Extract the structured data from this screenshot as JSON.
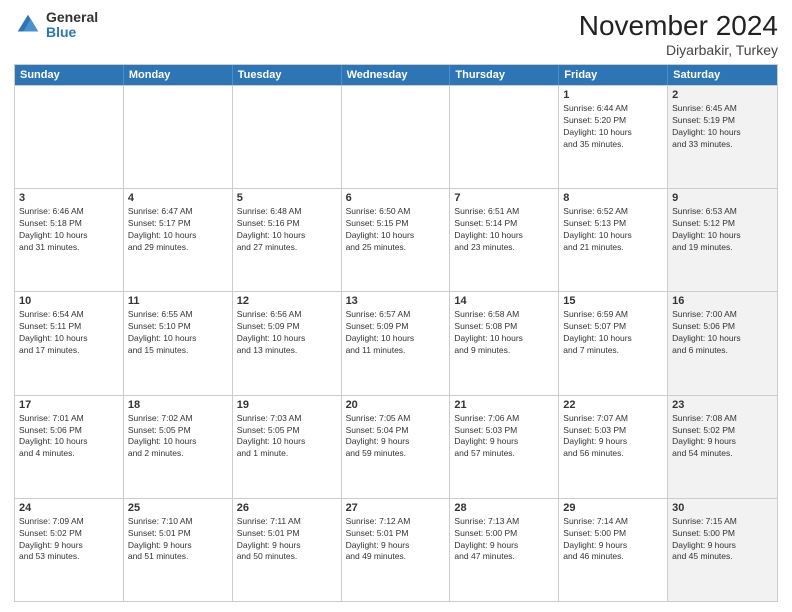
{
  "logo": {
    "general": "General",
    "blue": "Blue"
  },
  "header": {
    "month": "November 2024",
    "location": "Diyarbakir, Turkey"
  },
  "days": [
    "Sunday",
    "Monday",
    "Tuesday",
    "Wednesday",
    "Thursday",
    "Friday",
    "Saturday"
  ],
  "rows": [
    [
      {
        "day": "",
        "text": "",
        "shaded": false
      },
      {
        "day": "",
        "text": "",
        "shaded": false
      },
      {
        "day": "",
        "text": "",
        "shaded": false
      },
      {
        "day": "",
        "text": "",
        "shaded": false
      },
      {
        "day": "",
        "text": "",
        "shaded": false
      },
      {
        "day": "1",
        "text": "Sunrise: 6:44 AM\nSunset: 5:20 PM\nDaylight: 10 hours\nand 35 minutes.",
        "shaded": false
      },
      {
        "day": "2",
        "text": "Sunrise: 6:45 AM\nSunset: 5:19 PM\nDaylight: 10 hours\nand 33 minutes.",
        "shaded": true
      }
    ],
    [
      {
        "day": "3",
        "text": "Sunrise: 6:46 AM\nSunset: 5:18 PM\nDaylight: 10 hours\nand 31 minutes.",
        "shaded": false
      },
      {
        "day": "4",
        "text": "Sunrise: 6:47 AM\nSunset: 5:17 PM\nDaylight: 10 hours\nand 29 minutes.",
        "shaded": false
      },
      {
        "day": "5",
        "text": "Sunrise: 6:48 AM\nSunset: 5:16 PM\nDaylight: 10 hours\nand 27 minutes.",
        "shaded": false
      },
      {
        "day": "6",
        "text": "Sunrise: 6:50 AM\nSunset: 5:15 PM\nDaylight: 10 hours\nand 25 minutes.",
        "shaded": false
      },
      {
        "day": "7",
        "text": "Sunrise: 6:51 AM\nSunset: 5:14 PM\nDaylight: 10 hours\nand 23 minutes.",
        "shaded": false
      },
      {
        "day": "8",
        "text": "Sunrise: 6:52 AM\nSunset: 5:13 PM\nDaylight: 10 hours\nand 21 minutes.",
        "shaded": false
      },
      {
        "day": "9",
        "text": "Sunrise: 6:53 AM\nSunset: 5:12 PM\nDaylight: 10 hours\nand 19 minutes.",
        "shaded": true
      }
    ],
    [
      {
        "day": "10",
        "text": "Sunrise: 6:54 AM\nSunset: 5:11 PM\nDaylight: 10 hours\nand 17 minutes.",
        "shaded": false
      },
      {
        "day": "11",
        "text": "Sunrise: 6:55 AM\nSunset: 5:10 PM\nDaylight: 10 hours\nand 15 minutes.",
        "shaded": false
      },
      {
        "day": "12",
        "text": "Sunrise: 6:56 AM\nSunset: 5:09 PM\nDaylight: 10 hours\nand 13 minutes.",
        "shaded": false
      },
      {
        "day": "13",
        "text": "Sunrise: 6:57 AM\nSunset: 5:09 PM\nDaylight: 10 hours\nand 11 minutes.",
        "shaded": false
      },
      {
        "day": "14",
        "text": "Sunrise: 6:58 AM\nSunset: 5:08 PM\nDaylight: 10 hours\nand 9 minutes.",
        "shaded": false
      },
      {
        "day": "15",
        "text": "Sunrise: 6:59 AM\nSunset: 5:07 PM\nDaylight: 10 hours\nand 7 minutes.",
        "shaded": false
      },
      {
        "day": "16",
        "text": "Sunrise: 7:00 AM\nSunset: 5:06 PM\nDaylight: 10 hours\nand 6 minutes.",
        "shaded": true
      }
    ],
    [
      {
        "day": "17",
        "text": "Sunrise: 7:01 AM\nSunset: 5:06 PM\nDaylight: 10 hours\nand 4 minutes.",
        "shaded": false
      },
      {
        "day": "18",
        "text": "Sunrise: 7:02 AM\nSunset: 5:05 PM\nDaylight: 10 hours\nand 2 minutes.",
        "shaded": false
      },
      {
        "day": "19",
        "text": "Sunrise: 7:03 AM\nSunset: 5:05 PM\nDaylight: 10 hours\nand 1 minute.",
        "shaded": false
      },
      {
        "day": "20",
        "text": "Sunrise: 7:05 AM\nSunset: 5:04 PM\nDaylight: 9 hours\nand 59 minutes.",
        "shaded": false
      },
      {
        "day": "21",
        "text": "Sunrise: 7:06 AM\nSunset: 5:03 PM\nDaylight: 9 hours\nand 57 minutes.",
        "shaded": false
      },
      {
        "day": "22",
        "text": "Sunrise: 7:07 AM\nSunset: 5:03 PM\nDaylight: 9 hours\nand 56 minutes.",
        "shaded": false
      },
      {
        "day": "23",
        "text": "Sunrise: 7:08 AM\nSunset: 5:02 PM\nDaylight: 9 hours\nand 54 minutes.",
        "shaded": true
      }
    ],
    [
      {
        "day": "24",
        "text": "Sunrise: 7:09 AM\nSunset: 5:02 PM\nDaylight: 9 hours\nand 53 minutes.",
        "shaded": false
      },
      {
        "day": "25",
        "text": "Sunrise: 7:10 AM\nSunset: 5:01 PM\nDaylight: 9 hours\nand 51 minutes.",
        "shaded": false
      },
      {
        "day": "26",
        "text": "Sunrise: 7:11 AM\nSunset: 5:01 PM\nDaylight: 9 hours\nand 50 minutes.",
        "shaded": false
      },
      {
        "day": "27",
        "text": "Sunrise: 7:12 AM\nSunset: 5:01 PM\nDaylight: 9 hours\nand 49 minutes.",
        "shaded": false
      },
      {
        "day": "28",
        "text": "Sunrise: 7:13 AM\nSunset: 5:00 PM\nDaylight: 9 hours\nand 47 minutes.",
        "shaded": false
      },
      {
        "day": "29",
        "text": "Sunrise: 7:14 AM\nSunset: 5:00 PM\nDaylight: 9 hours\nand 46 minutes.",
        "shaded": false
      },
      {
        "day": "30",
        "text": "Sunrise: 7:15 AM\nSunset: 5:00 PM\nDaylight: 9 hours\nand 45 minutes.",
        "shaded": true
      }
    ]
  ]
}
